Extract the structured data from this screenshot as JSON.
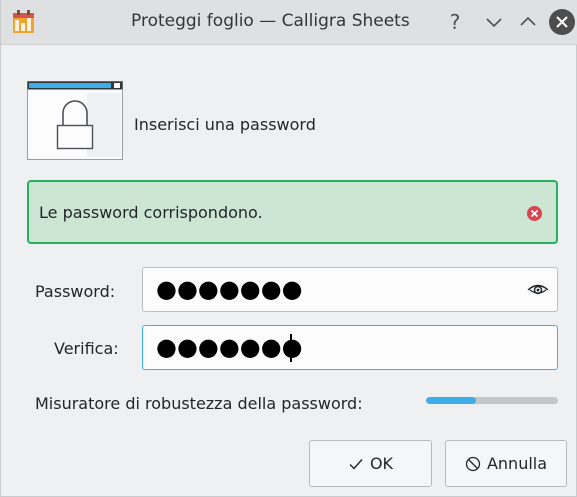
{
  "window": {
    "title": "Proteggi foglio — Calligra Sheets",
    "help_glyph": "?",
    "minimize_glyph": "⌄",
    "maximize_glyph": "⌃"
  },
  "header": {
    "text": "Inserisci una password",
    "icon": "lock-window-icon"
  },
  "message": {
    "text": "Le password corrispondono.",
    "close_icon": "close-circle-icon",
    "accent_color": "#27ae60"
  },
  "fields": {
    "password_label": "Password:",
    "password_value": "●●●●●●●",
    "verify_label": "Verifica:",
    "verify_value": "●●●●●●●"
  },
  "strength": {
    "label": "Misuratore di robustezza della password:",
    "level": 0.38,
    "color": "#3daee9"
  },
  "buttons": {
    "ok_label": "OK",
    "cancel_label": "Annulla"
  }
}
